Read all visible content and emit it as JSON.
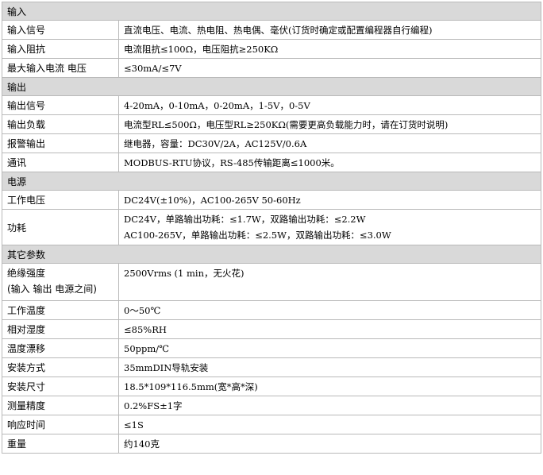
{
  "sections": [
    {
      "title": "输入",
      "rows": [
        {
          "label": [
            "输入信号"
          ],
          "value": [
            "直流电压、电流、热电阻、热电偶、毫伏(订货时确定或配置编程器自行编程)"
          ]
        },
        {
          "label": [
            "输入阻抗"
          ],
          "value": [
            "电流阻抗≤100Ω，电压阻抗≥250KΩ"
          ]
        },
        {
          "label": [
            "最大输入电流 电压"
          ],
          "value": [
            "≤30mA/≤7V"
          ]
        }
      ]
    },
    {
      "title": "输出",
      "rows": [
        {
          "label": [
            "输出信号"
          ],
          "value": [
            "4-20mA，0-10mA，0-20mA，1-5V，0-5V"
          ]
        },
        {
          "label": [
            "输出负载"
          ],
          "value": [
            "电流型RL≤500Ω，电压型RL≥250KΩ(需要更高负载能力时，请在订货时说明)"
          ]
        },
        {
          "label": [
            "报警输出"
          ],
          "value": [
            "继电器，容量：DC30V/2A，AC125V/0.6A"
          ]
        },
        {
          "label": [
            "通讯"
          ],
          "value": [
            "MODBUS-RTU协议，RS-485传输距离≤1000米。"
          ]
        }
      ]
    },
    {
      "title": "电源",
      "rows": [
        {
          "label": [
            "工作电压"
          ],
          "value": [
            "DC24V(±10%)，AC100-265V 50-60Hz"
          ]
        },
        {
          "label": [
            "功耗"
          ],
          "value": [
            "DC24V，单路输出功耗：≤1.7W，双路输出功耗：≤2.2W",
            "AC100-265V，单路输出功耗：≤2.5W，双路输出功耗：≤3.0W"
          ]
        }
      ]
    },
    {
      "title": "其它参数",
      "rows": [
        {
          "label": [
            "绝缘强度",
            "(输入 输出 电源之间)"
          ],
          "value": [
            "2500Vrms (1 min，无火花)"
          ]
        },
        {
          "label": [
            "工作温度"
          ],
          "value": [
            "0～50℃"
          ]
        },
        {
          "label": [
            "相对湿度"
          ],
          "value": [
            "≤85%RH"
          ]
        },
        {
          "label": [
            "温度漂移"
          ],
          "value": [
            "50ppm/℃"
          ]
        },
        {
          "label": [
            "安装方式"
          ],
          "value": [
            "35mmDIN导轨安装"
          ]
        },
        {
          "label": [
            "安装尺寸"
          ],
          "value": [
            "18.5*109*116.5mm(宽*高*深)"
          ]
        },
        {
          "label": [
            "测量精度"
          ],
          "value": [
            "0.2%FS±1字"
          ]
        },
        {
          "label": [
            "响应时间"
          ],
          "value": [
            "≤1S"
          ]
        },
        {
          "label": [
            "重量"
          ],
          "value": [
            "约140克"
          ]
        }
      ]
    }
  ]
}
